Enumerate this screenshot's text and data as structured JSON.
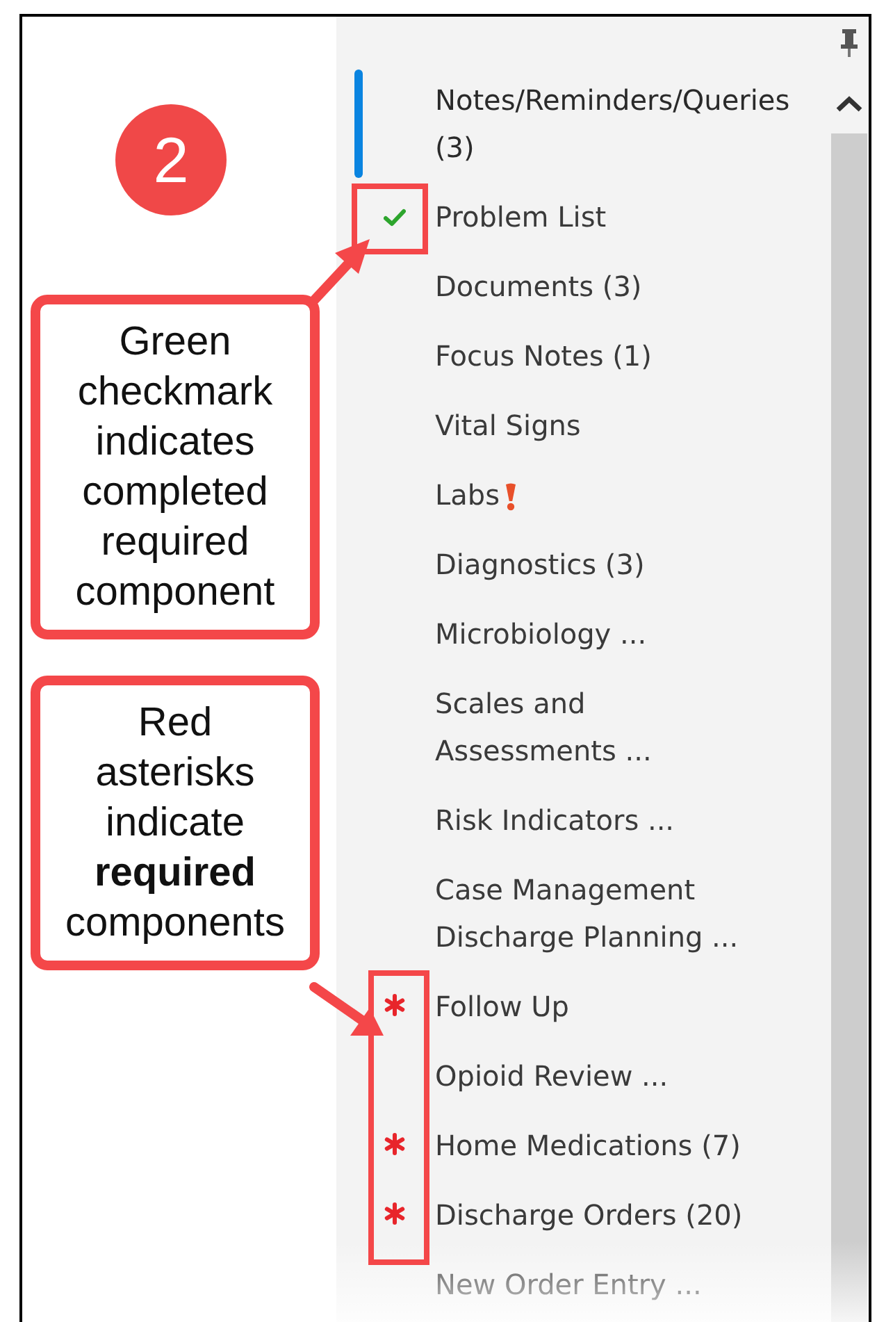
{
  "step_badge": "2",
  "callouts": [
    {
      "text": "Green\ncheckmark\nindicates\ncompleted\nrequired\ncomponent"
    },
    {
      "text": "Red\nasterisks\nindicate\n**required**\ncomponents"
    }
  ],
  "nav": {
    "items": [
      {
        "label": "Notes/Reminders/Queries\n(3)",
        "selected": true,
        "completed": false,
        "required": false,
        "alert": false
      },
      {
        "label": "Problem List",
        "selected": false,
        "completed": true,
        "required": false,
        "alert": false
      },
      {
        "label": "Documents (3)",
        "selected": false,
        "completed": false,
        "required": false,
        "alert": false
      },
      {
        "label": "Focus Notes (1)",
        "selected": false,
        "completed": false,
        "required": false,
        "alert": false
      },
      {
        "label": "Vital Signs",
        "selected": false,
        "completed": false,
        "required": false,
        "alert": false
      },
      {
        "label": "Labs",
        "selected": false,
        "completed": false,
        "required": false,
        "alert": true
      },
      {
        "label": "Diagnostics (3)",
        "selected": false,
        "completed": false,
        "required": false,
        "alert": false
      },
      {
        "label": "Microbiology ...",
        "selected": false,
        "completed": false,
        "required": false,
        "alert": false
      },
      {
        "label": "Scales and\nAssessments ...",
        "selected": false,
        "completed": false,
        "required": false,
        "alert": false
      },
      {
        "label": "Risk Indicators ...",
        "selected": false,
        "completed": false,
        "required": false,
        "alert": false
      },
      {
        "label": "Case Management\nDischarge Planning ...",
        "selected": false,
        "completed": false,
        "required": false,
        "alert": false
      },
      {
        "label": "Follow Up",
        "selected": false,
        "completed": false,
        "required": true,
        "alert": false
      },
      {
        "label": "Opioid Review ...",
        "selected": false,
        "completed": false,
        "required": false,
        "alert": false
      },
      {
        "label": "Home Medications (7)",
        "selected": false,
        "completed": false,
        "required": true,
        "alert": false
      },
      {
        "label": "Discharge Orders (20)",
        "selected": false,
        "completed": false,
        "required": true,
        "alert": false
      },
      {
        "label": "New Order Entry ...",
        "selected": false,
        "completed": false,
        "required": false,
        "alert": false
      }
    ]
  }
}
